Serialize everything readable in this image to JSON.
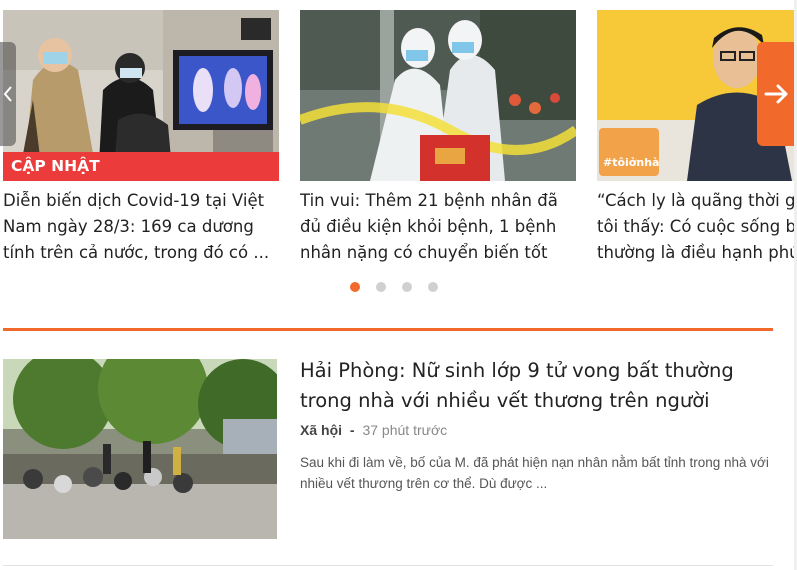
{
  "carousel": {
    "cards": [
      {
        "badge": "CẬP NHẬT",
        "title": "Diễn biến dịch Covid-19 tại Việt Nam ngày 28/3: 169 ca dương tính trên cả nước, trong đó có ..."
      },
      {
        "title": "Tin vui: Thêm 21 bệnh nhân đã đủ điều kiện khỏi bệnh, 1 bệnh nhân nặng có chuyển biến tốt"
      },
      {
        "title_lines": [
          "“Cách ly là quãng thời g",
          "tôi thấy: Có cuộc sống b",
          "thường là điều hạnh phú"
        ],
        "image_tag": "#tôiởnhà"
      }
    ],
    "next_icon": "arrow-right-icon",
    "prev_icon": "chevron-left-icon",
    "dots": {
      "count": 4,
      "active_index": 0
    }
  },
  "colors": {
    "accent": "#f26a2b",
    "badge_red": "#ec3b3b",
    "dot_inactive": "#d0d0d0"
  },
  "article": {
    "headline": "Hải Phòng: Nữ sinh lớp 9 tử vong bất thường trong nhà với nhiều vết thương trên người",
    "category": "Xã hội",
    "separator": "-",
    "time": "37 phút trước",
    "summary": "Sau khi đi làm về, bố của M. đã phát hiện nạn nhân nằm bất tỉnh trong nhà với nhiều vết thương trên cơ thể. Dù được ..."
  }
}
